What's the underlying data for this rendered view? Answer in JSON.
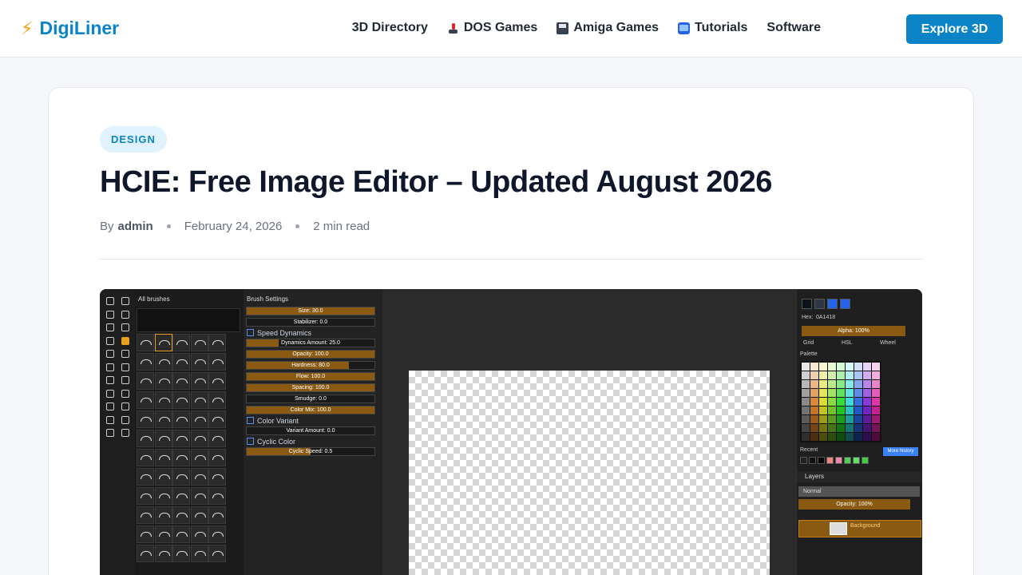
{
  "header": {
    "logo_text": "DigiLiner",
    "nav": [
      {
        "label": "3D Directory",
        "icon": null
      },
      {
        "label": "DOS Games",
        "icon": "joystick-icon"
      },
      {
        "label": "Amiga Games",
        "icon": "floppy-disk-icon"
      },
      {
        "label": "Tutorials",
        "icon": "tv-icon"
      },
      {
        "label": "Software",
        "icon": null
      }
    ],
    "cta_label": "Explore 3D",
    "accent_color": "#0a84c6"
  },
  "article": {
    "category": "DESIGN",
    "title": "HCIE: Free Image Editor – Updated August 2026",
    "author_prefix": "By",
    "author": "admin",
    "date": "February 24, 2026",
    "read_time": "2 min read"
  },
  "screenshot": {
    "brushes_header": "All brushes",
    "brush_settings_header": "Brush Settings",
    "sliders": [
      {
        "label": "Size: 30.0",
        "fill": 1.0
      },
      {
        "label": "Stabilizer: 0.0",
        "fill": 0.0
      },
      {
        "label": "Dynamics Amount: 25.0",
        "fill": 0.25
      },
      {
        "label": "Opacity: 100.0",
        "fill": 1.0
      },
      {
        "label": "Hardness: 80.0",
        "fill": 0.8
      },
      {
        "label": "Flow: 100.0",
        "fill": 1.0
      },
      {
        "label": "Spacing: 100.0",
        "fill": 1.0
      },
      {
        "label": "Smudge: 0.0",
        "fill": 0.0
      },
      {
        "label": "Color Mix: 100.0",
        "fill": 1.0
      },
      {
        "label": "Variant Amount: 0.0",
        "fill": 0.0
      },
      {
        "label": "Cyclic Speed: 0.5",
        "fill": 0.5
      }
    ],
    "sections": [
      "Speed Dynamics",
      "Color Variant",
      "Cyclic Color"
    ],
    "hex_label": "Hex:",
    "hex_value": "0A1418",
    "alpha_label": "Alpha: 100%",
    "tabs": [
      "Grid",
      "HSL",
      "Wheel"
    ],
    "palette_label": "Palette",
    "recent_label": "Recent",
    "more_history": "More history",
    "layers_label": "Layers",
    "blend_mode": "Normal",
    "layer_opacity": "Opacity: 100%",
    "layer_name": "Background"
  }
}
